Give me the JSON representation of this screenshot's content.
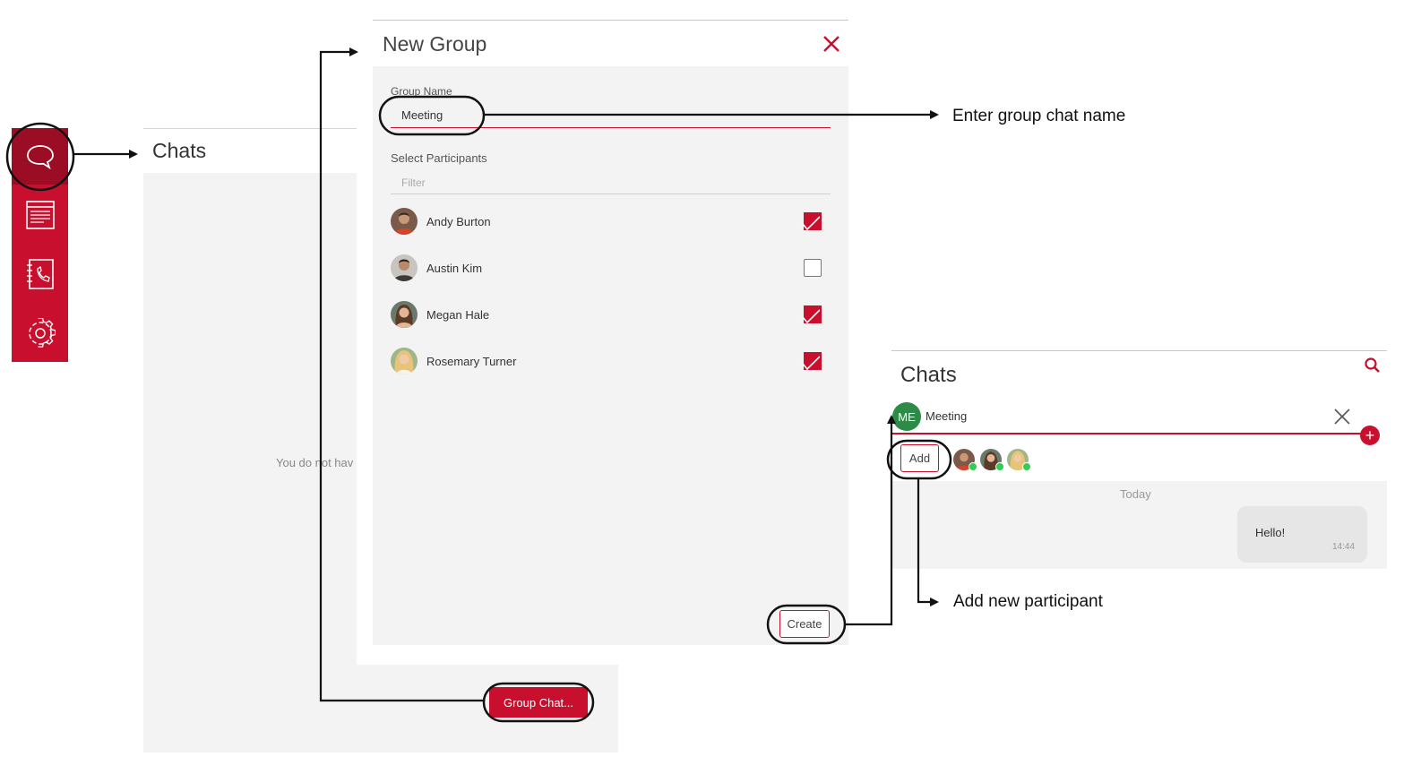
{
  "sidebar": {
    "items": [
      {
        "name": "chats",
        "icon": "chat-bubble-icon"
      },
      {
        "name": "news",
        "icon": "newspaper-icon"
      },
      {
        "name": "contacts",
        "icon": "phonebook-icon"
      },
      {
        "name": "settings",
        "icon": "gear-icon"
      }
    ]
  },
  "chats_panel": {
    "title": "Chats",
    "empty_text": "You do not hav",
    "group_chat_button": "Group Chat..."
  },
  "dialog": {
    "title": "New Group",
    "group_name_label": "Group Name",
    "group_name_value": "Meeting",
    "participants_label": "Select Participants",
    "filter_placeholder": "Filter",
    "participants": [
      {
        "name": "Andy Burton",
        "checked": true
      },
      {
        "name": "Austin Kim",
        "checked": false
      },
      {
        "name": "Megan Hale",
        "checked": true
      },
      {
        "name": "Rosemary Turner",
        "checked": true
      }
    ],
    "create_button": "Create"
  },
  "result": {
    "title": "Chats",
    "avatar_initials": "ME",
    "chat_name": "Meeting",
    "add_button": "Add",
    "date_divider": "Today",
    "message": {
      "text": "Hello!",
      "time": "14:44"
    }
  },
  "annotations": {
    "group_name": "Enter group chat name",
    "add_participant": "Add new participant"
  },
  "colors": {
    "accent": "#c8102e",
    "accent_dark": "#9b0d25",
    "online": "#33cc55",
    "me_avatar": "#2e8b47"
  }
}
